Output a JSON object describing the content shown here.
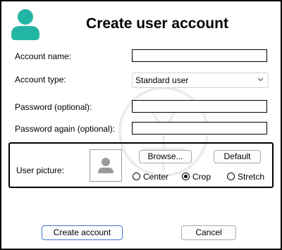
{
  "dialog": {
    "title": "Create user account"
  },
  "form": {
    "account_name_label": "Account name:",
    "account_name_value": "",
    "account_type_label": "Account type:",
    "account_type_value": "Standard user",
    "password_label": "Password (optional):",
    "password_value": "",
    "password_again_label": "Password again (optional):",
    "password_again_value": ""
  },
  "picture": {
    "label": "User picture:",
    "browse_label": "Browse...",
    "default_label": "Default",
    "options": [
      "Center",
      "Crop",
      "Stretch"
    ],
    "selected": "Crop"
  },
  "footer": {
    "create_label": "Create account",
    "cancel_label": "Cancel"
  },
  "icons": {
    "header": "user-account-icon",
    "thumbnail": "user-placeholder-icon",
    "chevron": "chevron-down-icon"
  },
  "colors": {
    "accent_teal": "#22b5a4",
    "primary_border": "#3a7bd5",
    "thumb_gray": "#9a9a9a"
  }
}
